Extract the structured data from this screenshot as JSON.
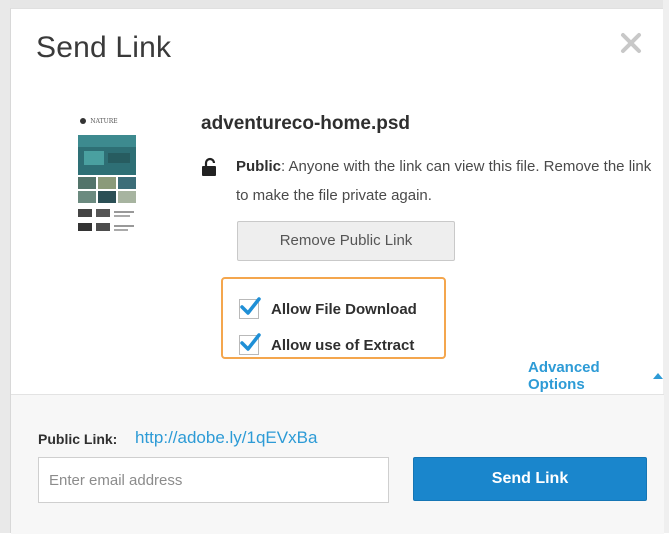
{
  "dialog": {
    "title": "Send Link",
    "close_icon": "close-icon"
  },
  "file": {
    "thumbnail_caption": "NATURE",
    "name": "adventureco-home.psd"
  },
  "visibility": {
    "lock_icon": "unlock-icon",
    "label": "Public",
    "description": ": Anyone with the link can view this file. Remove the link to make the file private again."
  },
  "buttons": {
    "remove_public_link": "Remove Public Link",
    "send_link": "Send Link"
  },
  "options": [
    {
      "label": "Allow File Download",
      "checked": true
    },
    {
      "label": "Allow use of Extract",
      "checked": true
    }
  ],
  "advanced": {
    "label": "Advanced Options",
    "icon": "caret-up-icon"
  },
  "footer": {
    "public_link_label": "Public Link:",
    "public_link_url": "http://adobe.ly/1qEVxBa",
    "email_placeholder": "Enter email address"
  },
  "colors": {
    "accent": "#2d9bd6",
    "send_button": "#1a86cc",
    "highlight_border": "#f4a64d",
    "checkmark": "#1f8fd6"
  }
}
